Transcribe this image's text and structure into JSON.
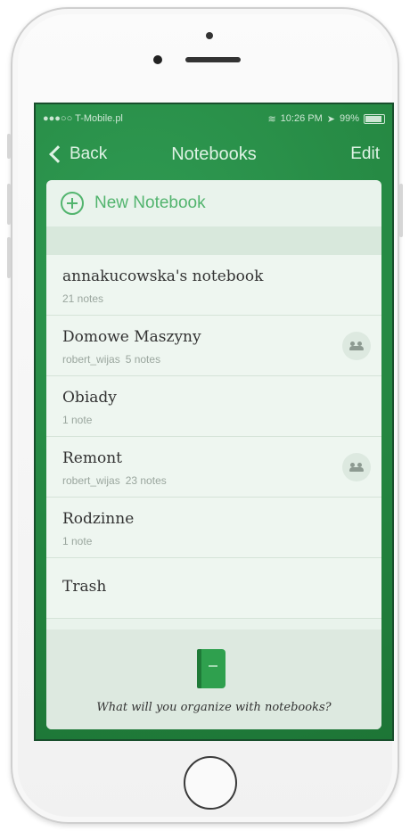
{
  "status_bar": {
    "carrier": "●●●○○ T-Mobile.pl",
    "wifi_icon": "wifi-icon",
    "time": "10:26 PM",
    "battery": "99%",
    "battery_level": 0.99
  },
  "nav": {
    "back_label": "Back",
    "title": "Notebooks",
    "edit_label": "Edit"
  },
  "new_notebook": {
    "label": "New Notebook",
    "icon": "plus-circle-icon"
  },
  "notebooks": [
    {
      "name": "annakucowska's notebook",
      "owner": "",
      "count": "21 notes",
      "shared": false
    },
    {
      "name": "Domowe Maszyny",
      "owner": "robert_wijas",
      "count": "5 notes",
      "shared": true
    },
    {
      "name": "Obiady",
      "owner": "",
      "count": "1 note",
      "shared": false
    },
    {
      "name": "Remont",
      "owner": "robert_wijas",
      "count": "23 notes",
      "shared": true
    },
    {
      "name": "Rodzinne",
      "owner": "",
      "count": "1 note",
      "shared": false
    }
  ],
  "trash": {
    "label": "Trash"
  },
  "footer": {
    "text": "What will you organize with notebooks?"
  },
  "colors": {
    "accent": "#52b46e",
    "background": "#23843f",
    "card": "#e9f3ec"
  }
}
